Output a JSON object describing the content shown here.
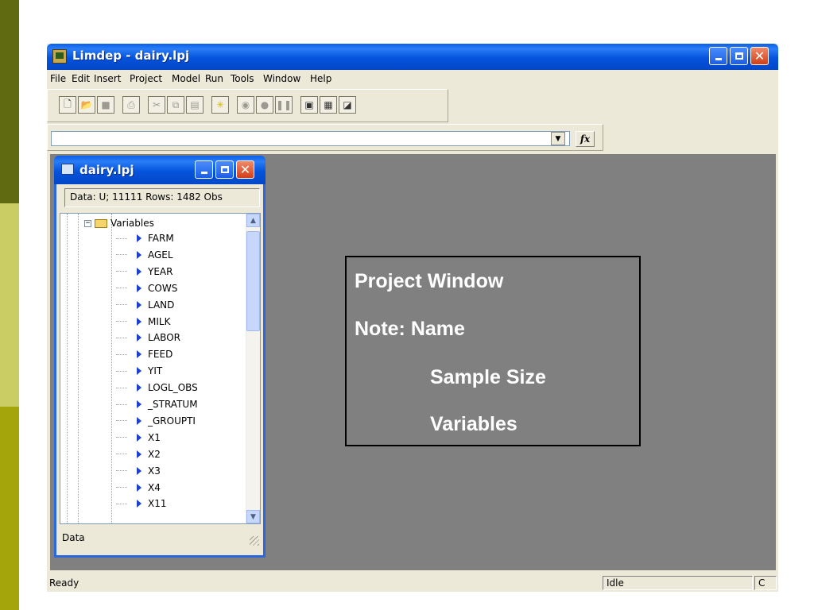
{
  "window": {
    "title": "Limdep - dairy.lpj"
  },
  "menu": [
    "File",
    "Edit",
    "Insert",
    "Project",
    "Model",
    "Run",
    "Tools",
    "Window",
    "Help"
  ],
  "toolbar": {
    "icons": [
      "new-file-icon",
      "open-folder-icon",
      "save-icon",
      "print-icon",
      "cut-icon",
      "copy-icon",
      "paste-icon",
      "star-icon",
      "go-icon",
      "stop-icon",
      "pause-icon",
      "project-icon",
      "grid-icon",
      "chart-icon"
    ]
  },
  "formula_bar": {
    "value": "",
    "fx_label": "fx"
  },
  "child_window": {
    "title": "dairy.lpj",
    "info": "Data: U; 11111 Rows: 1482 Obs",
    "folder": "Variables",
    "variables": [
      "FARM",
      "AGEL",
      "YEAR",
      "COWS",
      "LAND",
      "MILK",
      "LABOR",
      "FEED",
      "YIT",
      "LOGL_OBS",
      "_STRATUM",
      "_GROUPTI",
      "X1",
      "X2",
      "X3",
      "X4",
      "X11"
    ],
    "status": "Data"
  },
  "note": {
    "line1": "Project Window",
    "line2": "Note: Name",
    "line3": "Sample Size",
    "line4": "Variables"
  },
  "statusbar": {
    "left": "Ready",
    "middle": "Idle",
    "right": "C"
  },
  "colors": {
    "titlebar": "#0553dc",
    "mdi_background": "#808080",
    "sidebar_top": "#5f6a11",
    "sidebar_mid": "#c9cd63",
    "sidebar_bottom": "#a4a40b"
  }
}
